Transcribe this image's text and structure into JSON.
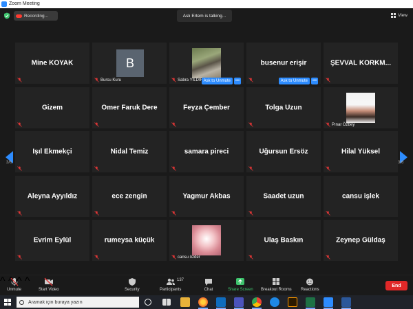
{
  "window": {
    "title": "Zoom Meeting"
  },
  "meeting": {
    "recording_label": "Recording...",
    "talking_label": "Aslı Ertem is talking...",
    "view_label": "View",
    "page_indicator_left": "3/6",
    "page_indicator_right": "3/6"
  },
  "unmute": {
    "label": "Ask to Unmute",
    "more": "•••"
  },
  "tiles": [
    {
      "name": "Mine KOYAK"
    },
    {
      "name": "Burcu Kuru",
      "avatar": "B"
    },
    {
      "name": "Sabra YILDIRIM"
    },
    {
      "name": "busenur erişir"
    },
    {
      "name": "ŞEVVAL  KORKM..."
    },
    {
      "name": "Gizem"
    },
    {
      "name": "Ömer Faruk Dere"
    },
    {
      "name": "Feyza Çember"
    },
    {
      "name": "Tolga Uzun"
    },
    {
      "name": "Pınar Özbey"
    },
    {
      "name": "Işıl Ekmekçi"
    },
    {
      "name": "Nidal Temiz"
    },
    {
      "name": "samara pireci"
    },
    {
      "name": "Uğursun Ersöz"
    },
    {
      "name": "Hilal Yüksel"
    },
    {
      "name": "Aleyna Ayyıldız"
    },
    {
      "name": "ece zengin"
    },
    {
      "name": "Yagmur Akbas"
    },
    {
      "name": "Saadet uzun"
    },
    {
      "name": "cansu işlek"
    },
    {
      "name": "Evrim Eylül"
    },
    {
      "name": "rumeysa küçük"
    },
    {
      "name": "cansu özder"
    },
    {
      "name": "Ulaş Baskın"
    },
    {
      "name": "Zeynep Güldaş"
    }
  ],
  "toolbar": {
    "unmute": "Unmute",
    "start_video": "Start Video",
    "security": "Security",
    "participants": "Participants",
    "participants_count": "137",
    "chat": "Chat",
    "share_screen": "Share Screen",
    "breakout_rooms": "Breakout Rooms",
    "reactions": "Reactions",
    "end": "End"
  },
  "taskbar": {
    "search_placeholder": "Aramak için buraya yazın"
  },
  "colors": {
    "accent": "#2d8cff",
    "end_red": "#e02828",
    "mute_red": "#e23636",
    "share_green": "#3ec46d"
  }
}
